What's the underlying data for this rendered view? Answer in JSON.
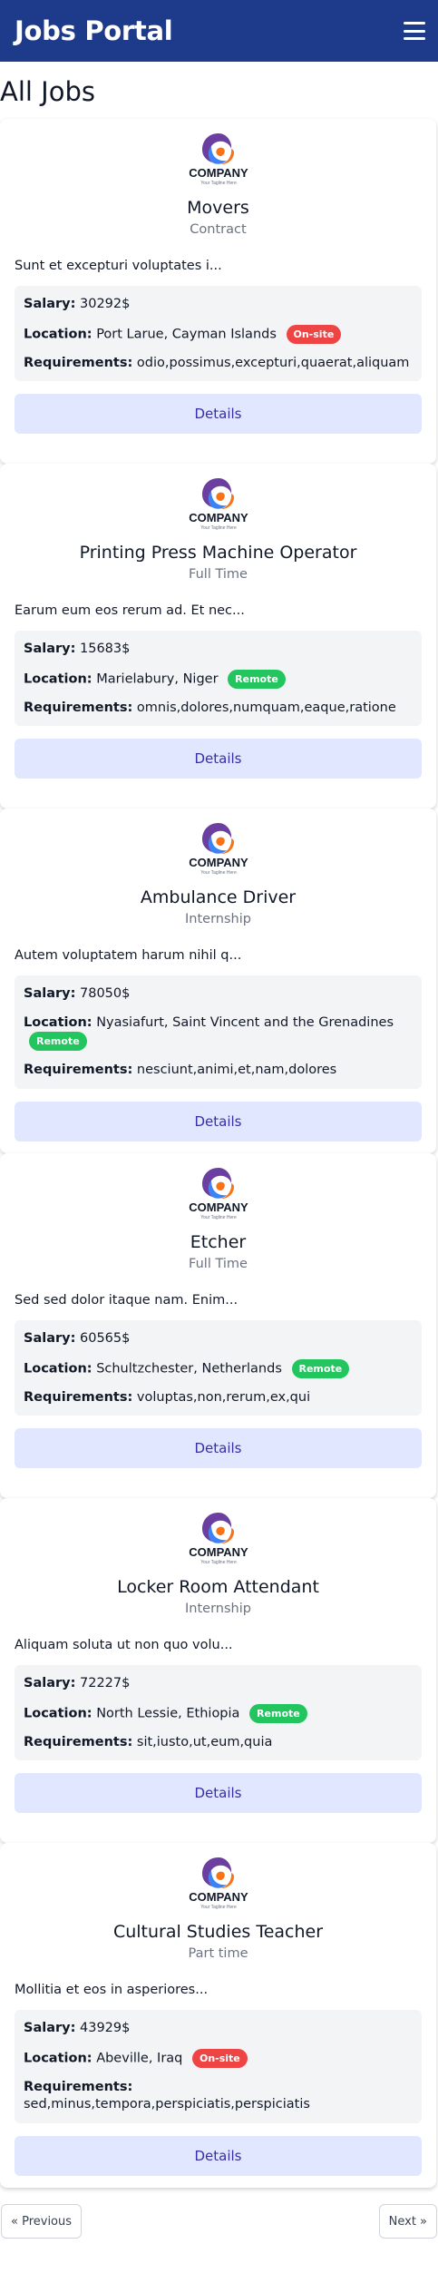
{
  "header": {
    "brand": "Jobs Portal",
    "menu_icon": "hamburger-menu-icon",
    "background_color": "#1e3a8a"
  },
  "page": {
    "title": "All Jobs"
  },
  "logo": {
    "company": "COMPANY",
    "tagline": "Your Tagline Here",
    "colors": [
      "#6b3fa0",
      "#3b82f6",
      "#f97316"
    ]
  },
  "jobs": [
    {
      "title": "Movers",
      "type": "Contract",
      "description": "Sunt et excepturi voluptates i...",
      "salary_label": "Salary:",
      "salary": "30292$",
      "location_label": "Location:",
      "location": "Port Larue, Cayman Islands",
      "badge": "On-site",
      "badge_kind": "onsite",
      "requirements_label": "Requirements:",
      "requirements": "odio,possimus,excepturi,quaerat,aliquam",
      "button": "Details"
    },
    {
      "title": "Printing Press Machine Operator",
      "type": "Full Time",
      "description": "Earum eum eos rerum ad. Et nec...",
      "salary_label": "Salary:",
      "salary": "15683$",
      "location_label": "Location:",
      "location": "Marielabury, Niger",
      "badge": "Remote",
      "badge_kind": "remote",
      "requirements_label": "Requirements:",
      "requirements": "omnis,dolores,numquam,eaque,ratione",
      "button": "Details"
    },
    {
      "title": "Ambulance Driver",
      "type": "Internship",
      "description": "Autem voluptatem harum nihil q...",
      "salary_label": "Salary:",
      "salary": "78050$",
      "location_label": "Location:",
      "location": "Nyasiafurt, Saint Vincent and the Grenadines",
      "badge": "Remote",
      "badge_kind": "remote",
      "requirements_label": "Requirements:",
      "requirements": "nesciunt,animi,et,nam,dolores",
      "button": "Details"
    },
    {
      "title": "Etcher",
      "type": "Full Time",
      "description": "Sed sed dolor itaque nam. Enim...",
      "salary_label": "Salary:",
      "salary": "60565$",
      "location_label": "Location:",
      "location": "Schultzchester, Netherlands",
      "badge": "Remote",
      "badge_kind": "remote",
      "requirements_label": "Requirements:",
      "requirements": "voluptas,non,rerum,ex,qui",
      "button": "Details"
    },
    {
      "title": "Locker Room Attendant",
      "type": "Internship",
      "description": "Aliquam soluta ut non quo volu...",
      "salary_label": "Salary:",
      "salary": "72227$",
      "location_label": "Location:",
      "location": "North Lessie, Ethiopia",
      "badge": "Remote",
      "badge_kind": "remote",
      "requirements_label": "Requirements:",
      "requirements": "sit,iusto,ut,eum,quia",
      "button": "Details"
    },
    {
      "title": "Cultural Studies Teacher",
      "type": "Part time",
      "description": "Mollitia et eos in asperiores...",
      "salary_label": "Salary:",
      "salary": "43929$",
      "location_label": "Location:",
      "location": "Abeville, Iraq",
      "badge": "On-site",
      "badge_kind": "onsite",
      "requirements_label": "Requirements:",
      "requirements": "sed,minus,tempora,perspiciatis,perspiciatis",
      "button": "Details"
    }
  ],
  "pagination": {
    "previous": "« Previous",
    "next": "Next »"
  }
}
